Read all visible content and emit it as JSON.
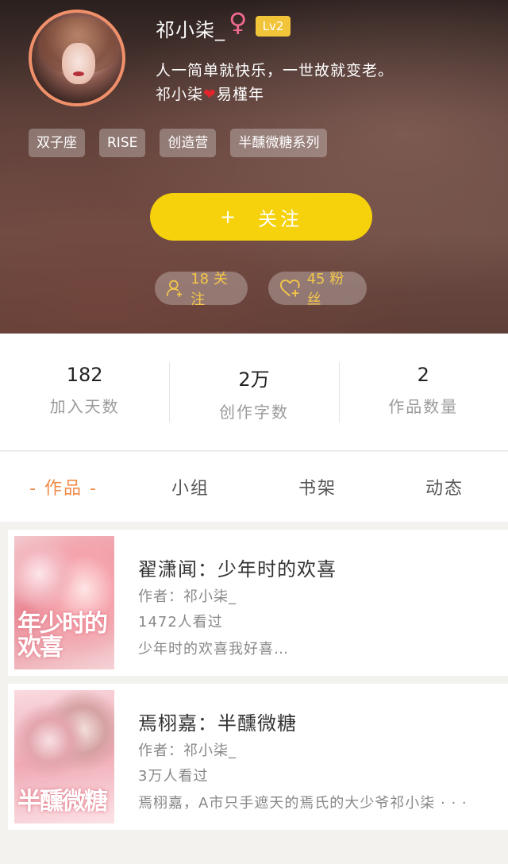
{
  "profile": {
    "name": "祁小柒_",
    "gender_icon": "female-symbol",
    "gender_symbol": "♀",
    "level": "Lv2",
    "signature_line1": "人一简单就快乐，一世故就变老。",
    "signature_line2_prefix": "祁小柒",
    "signature_heart": "❤",
    "signature_line2_suffix": "易槿年",
    "tags": [
      "双子座",
      "RISE",
      "创造营",
      "半醺微糖系列"
    ],
    "follow_button": {
      "icon": "+",
      "label": "关注"
    },
    "following_label": "18 关注",
    "fans_label": "45 粉丝"
  },
  "stats": [
    {
      "value": "182",
      "label": "加入天数"
    },
    {
      "value": "2万",
      "label": "创作字数"
    },
    {
      "value": "2",
      "label": "作品数量"
    }
  ],
  "tabs": [
    {
      "label": "- 作品 -",
      "active": true
    },
    {
      "label": "小组",
      "active": false
    },
    {
      "label": "书架",
      "active": false
    },
    {
      "label": "动态",
      "active": false
    }
  ],
  "works": [
    {
      "title": "翟潇闻：少年时的欢喜",
      "author": "作者：祁小柒_",
      "views": "1472人看过",
      "description": "少年时的欢喜我好喜…",
      "cover_text": "年少时的欢喜"
    },
    {
      "title": "焉栩嘉：半醺微糖",
      "author": "作者：祁小柒_",
      "views": "3万人看过",
      "description": "焉栩嘉，A市只手遮天的焉氏的大少爷祁小柒 · · ·",
      "cover_text": "半醺微糖"
    }
  ],
  "colors": {
    "accent_orange": "#f08c4a",
    "follow_yellow": "#f6d20c",
    "pill_text": "#f3c64a",
    "avatar_ring": "#f0906a",
    "gender_pink": "#f06a8e",
    "level_badge": "#f2c43a"
  }
}
